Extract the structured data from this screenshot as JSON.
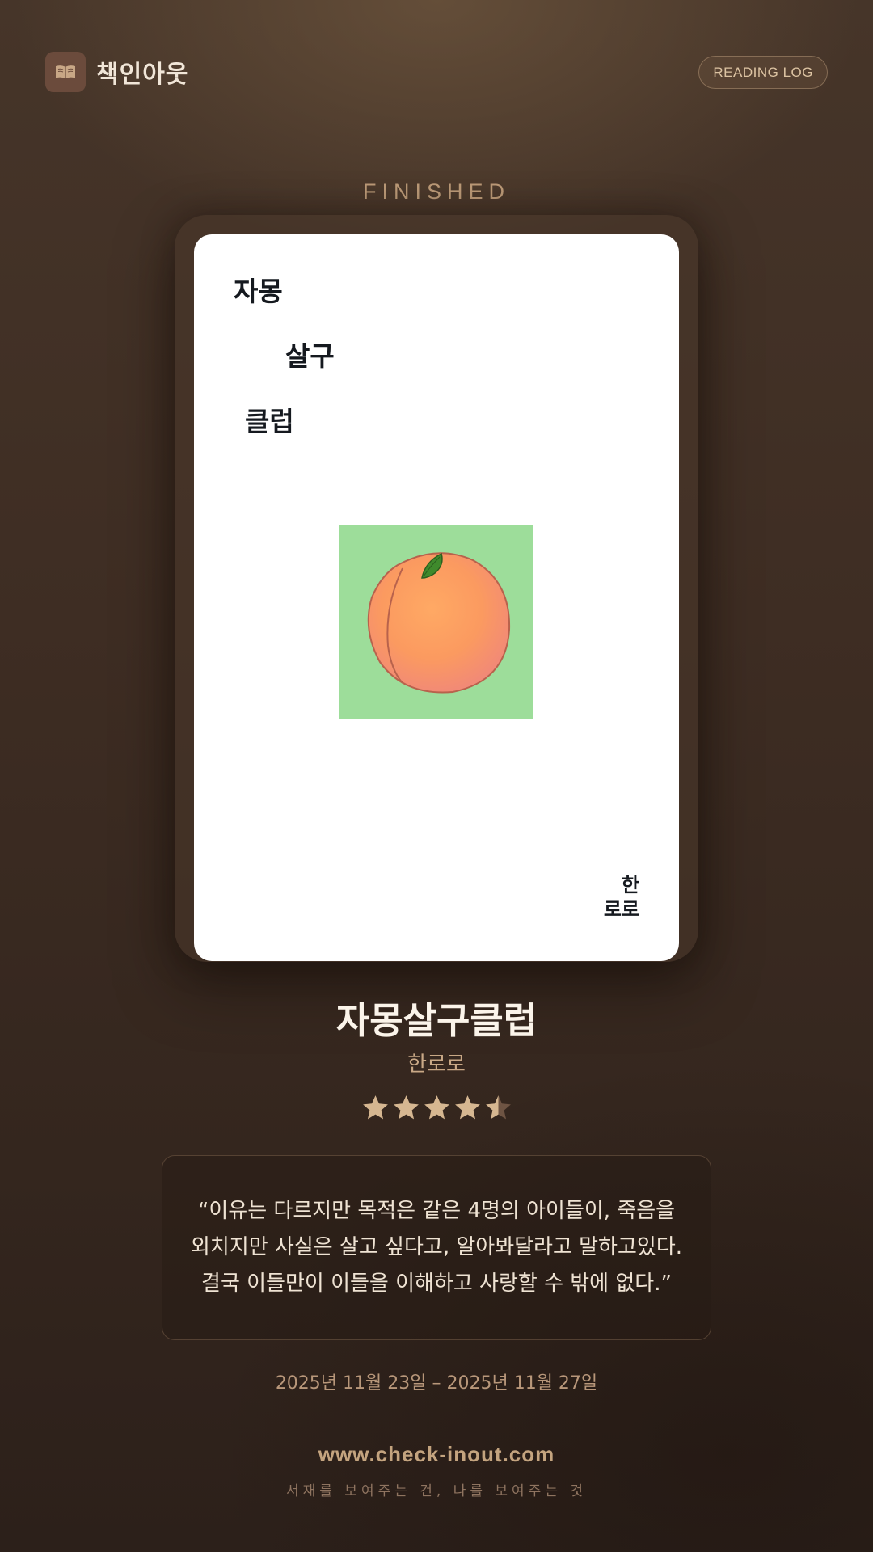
{
  "header": {
    "brand_name": "책인아웃",
    "brand_icon": "open-book-icon",
    "reading_log_label": "READING LOG"
  },
  "status_label": "FINISHED",
  "cover": {
    "title_lines": [
      "자몽",
      "살구",
      "클럽"
    ],
    "author_lines": [
      "한",
      "로로"
    ],
    "art": "peach-illustration",
    "art_bg_color": "#9ddd9a"
  },
  "book": {
    "title": "자몽살구클럽",
    "author": "한로로",
    "rating": 4.5,
    "rating_max": 5
  },
  "quote": "“이유는 다르지만 목적은 같은 4명의 아이들이, 죽음을 외치지만 사실은 살고 싶다고, 알아봐달라고 말하고있다. 결국 이들만이 이들을 이해하고 사랑할 수 밖에 없다.”",
  "reading_period": "2025년 11월 23일 – 2025년 11월 27일",
  "footer": {
    "url": "www.check-inout.com",
    "tagline": "서재를 보여주는 건, 나를 보여주는 것"
  },
  "colors": {
    "accent": "#c4a47f",
    "star": "#d6b791",
    "background": "#3e2d23"
  }
}
